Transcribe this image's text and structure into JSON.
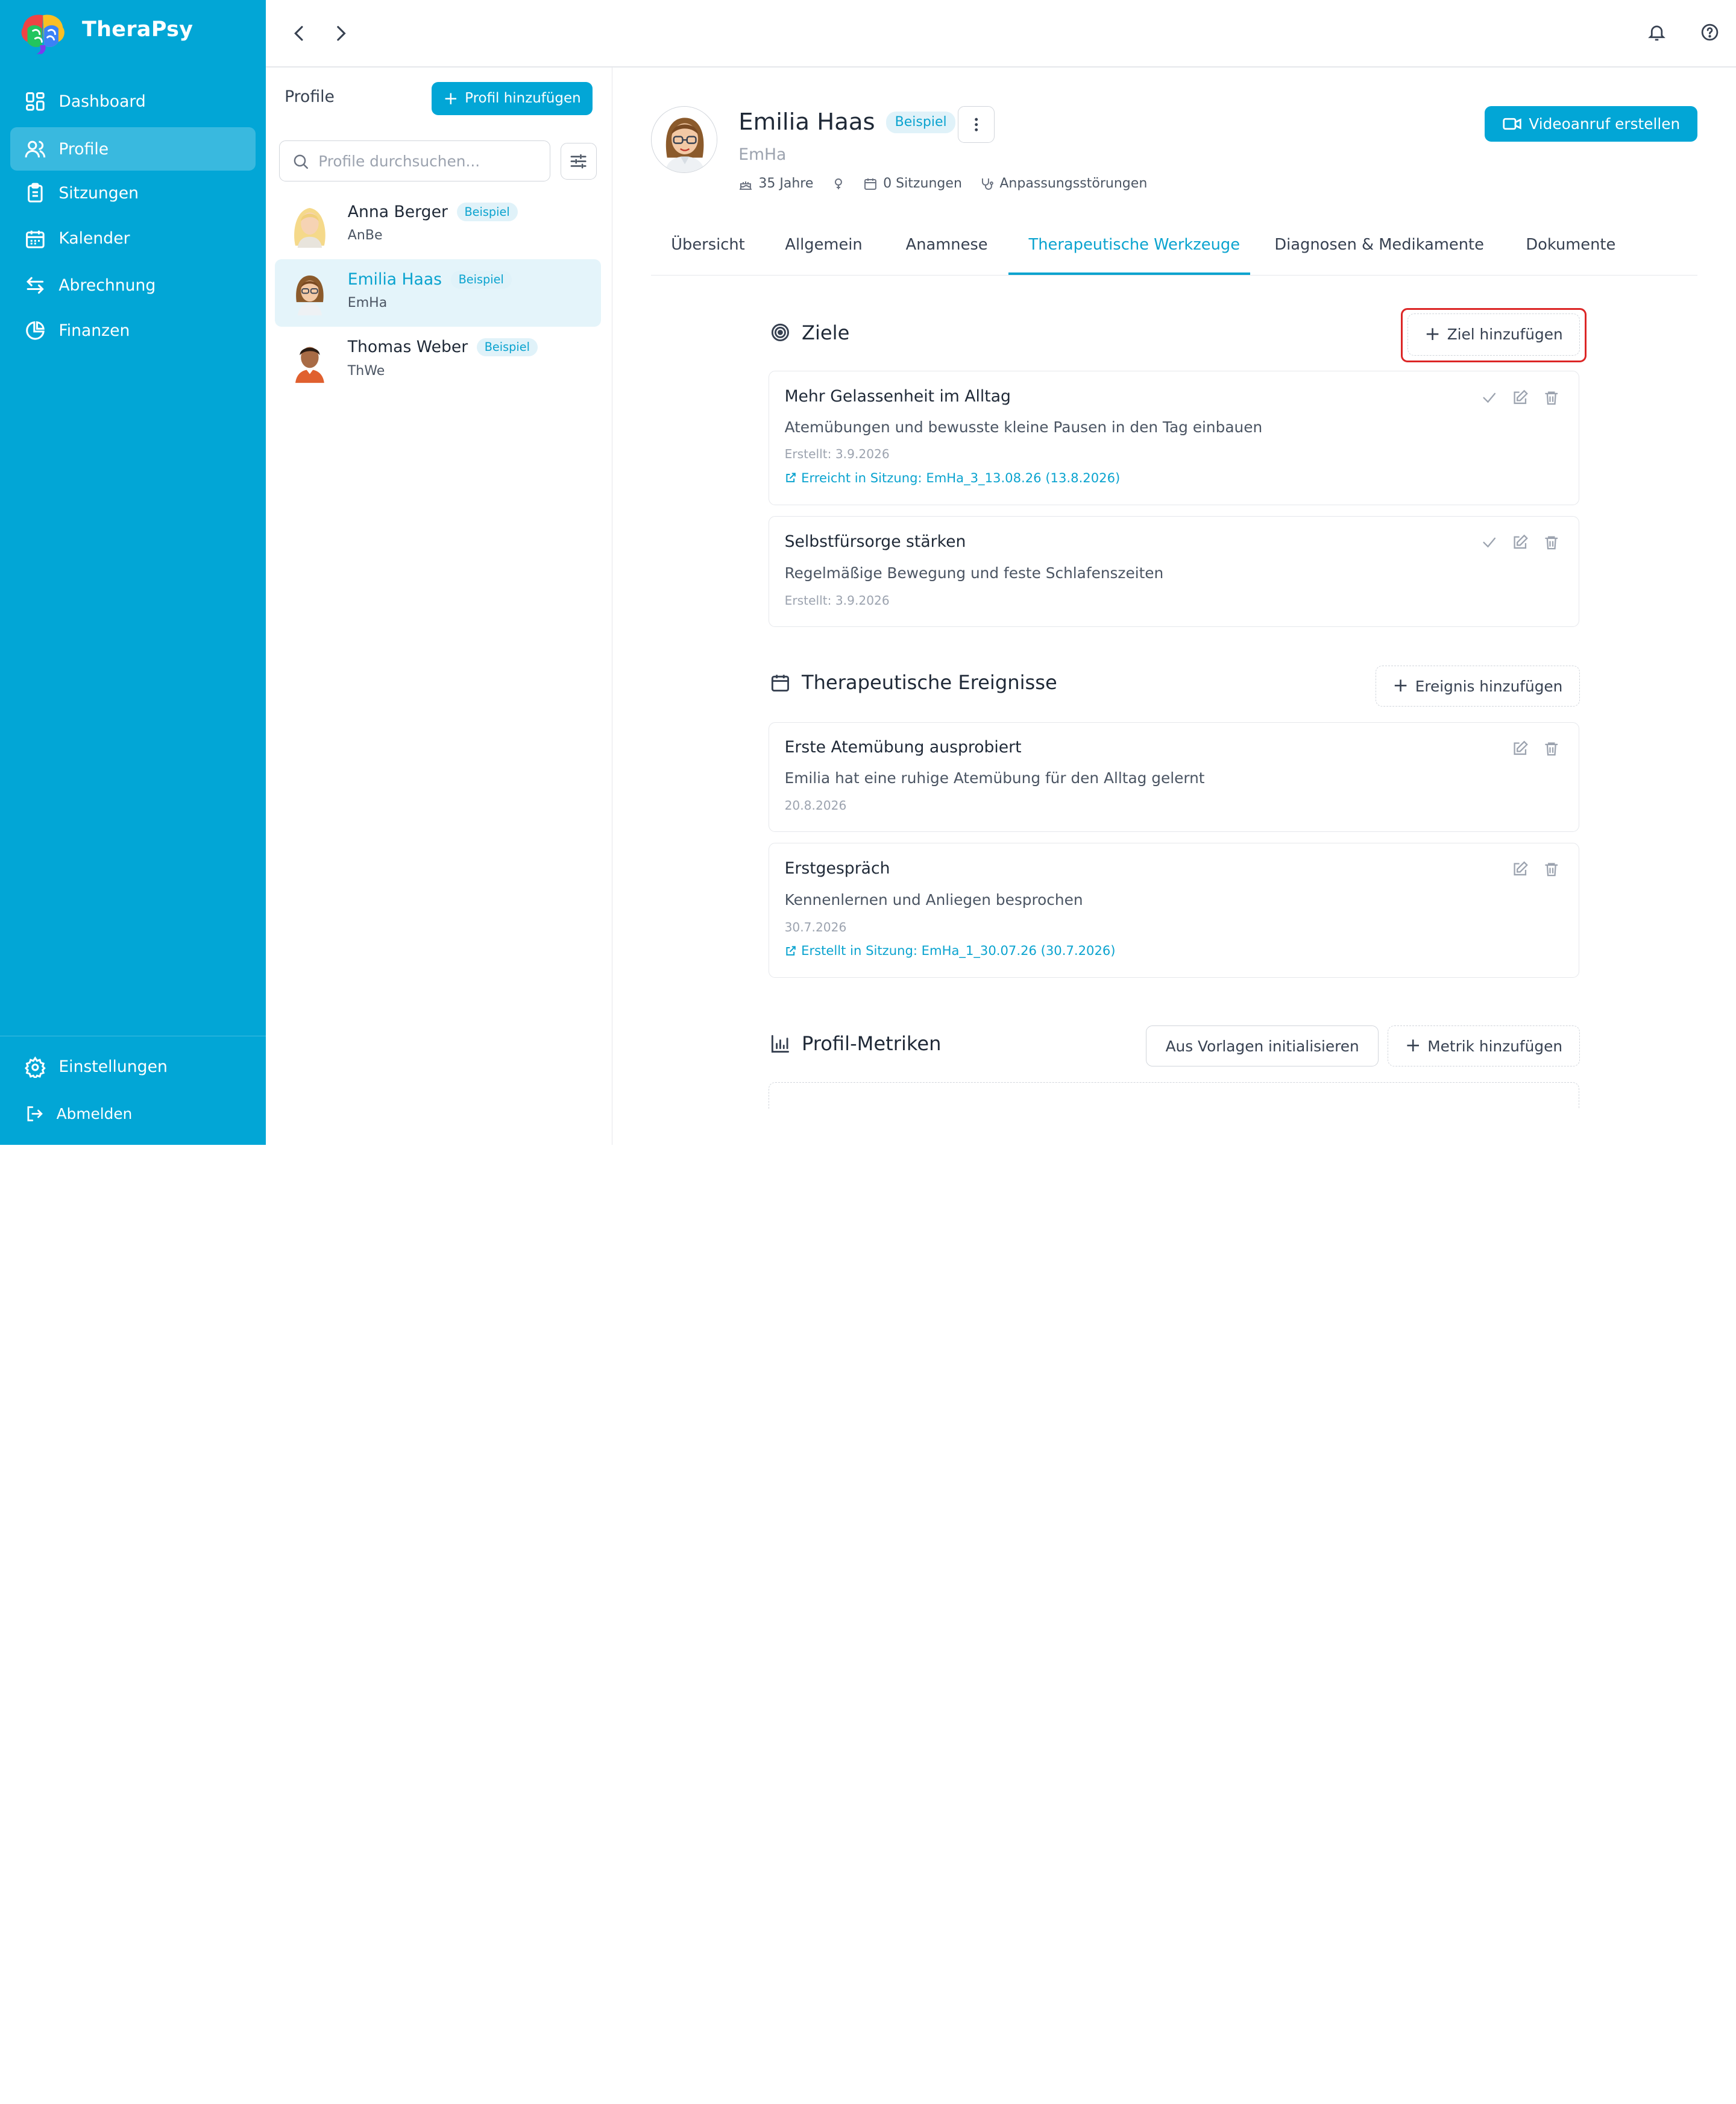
{
  "app": {
    "name": "TheraPsy"
  },
  "sidebar": {
    "items": [
      {
        "label": "Dashboard",
        "icon": "dashboard-icon"
      },
      {
        "label": "Profile",
        "icon": "users-icon",
        "active": true
      },
      {
        "label": "Sitzungen",
        "icon": "clipboard-icon"
      },
      {
        "label": "Kalender",
        "icon": "calendar-icon"
      },
      {
        "label": "Abrechnung",
        "icon": "arrows-swap-icon"
      },
      {
        "label": "Finanzen",
        "icon": "pie-chart-icon"
      }
    ],
    "settings_label": "Einstellungen",
    "logout_label": "Abmelden"
  },
  "profiles_panel": {
    "title": "Profile",
    "add_button": "Profil hinzufügen",
    "search_placeholder": "Profile durchsuchen...",
    "items": [
      {
        "name": "Anna Berger",
        "badge": "Beispiel",
        "code": "AnBe"
      },
      {
        "name": "Emilia Haas",
        "badge": "Beispiel",
        "code": "EmHa",
        "active": true
      },
      {
        "name": "Thomas Weber",
        "badge": "Beispiel",
        "code": "ThWe"
      }
    ]
  },
  "profile": {
    "name": "Emilia Haas",
    "badge": "Beispiel",
    "code": "EmHa",
    "age": "35 Jahre",
    "sessions": "0 Sitzungen",
    "diagnosis": "Anpassungsstörungen",
    "video_button": "Videoanruf erstellen"
  },
  "tabs": [
    {
      "label": "Übersicht"
    },
    {
      "label": "Allgemein"
    },
    {
      "label": "Anamnese"
    },
    {
      "label": "Therapeutische Werkzeuge",
      "active": true
    },
    {
      "label": "Diagnosen & Medikamente"
    },
    {
      "label": "Dokumente"
    }
  ],
  "goals": {
    "title": "Ziele",
    "add_button": "Ziel hinzufügen",
    "items": [
      {
        "title": "Mehr Gelassenheit im Alltag",
        "description": "Atemübungen und bewusste kleine Pausen in den Tag einbauen",
        "created": "Erstellt: 3.9.2026",
        "link": "Erreicht in Sitzung: EmHa_3_13.08.26 (13.8.2026)"
      },
      {
        "title": "Selbstfürsorge stärken",
        "description": "Regelmäßige Bewegung und feste Schlafenszeiten",
        "created": "Erstellt: 3.9.2026"
      }
    ]
  },
  "events": {
    "title": "Therapeutische Ereignisse",
    "add_button": "Ereignis hinzufügen",
    "items": [
      {
        "title": "Erste Atemübung ausprobiert",
        "description": "Emilia hat eine ruhige Atemübung für den Alltag gelernt",
        "date": "20.8.2026"
      },
      {
        "title": "Erstgespräch",
        "description": "Kennenlernen und Anliegen besprochen",
        "date": "30.7.2026",
        "link": "Erstellt in Sitzung: EmHa_1_30.07.26 (30.7.2026)"
      }
    ]
  },
  "metrics": {
    "title": "Profil-Metriken",
    "init_button": "Aus Vorlagen initialisieren",
    "add_button": "Metrik hinzufügen"
  },
  "colors": {
    "sidebar": "#02a6d6",
    "accent": "#0aa3cf",
    "highlight": "#dc2626"
  }
}
